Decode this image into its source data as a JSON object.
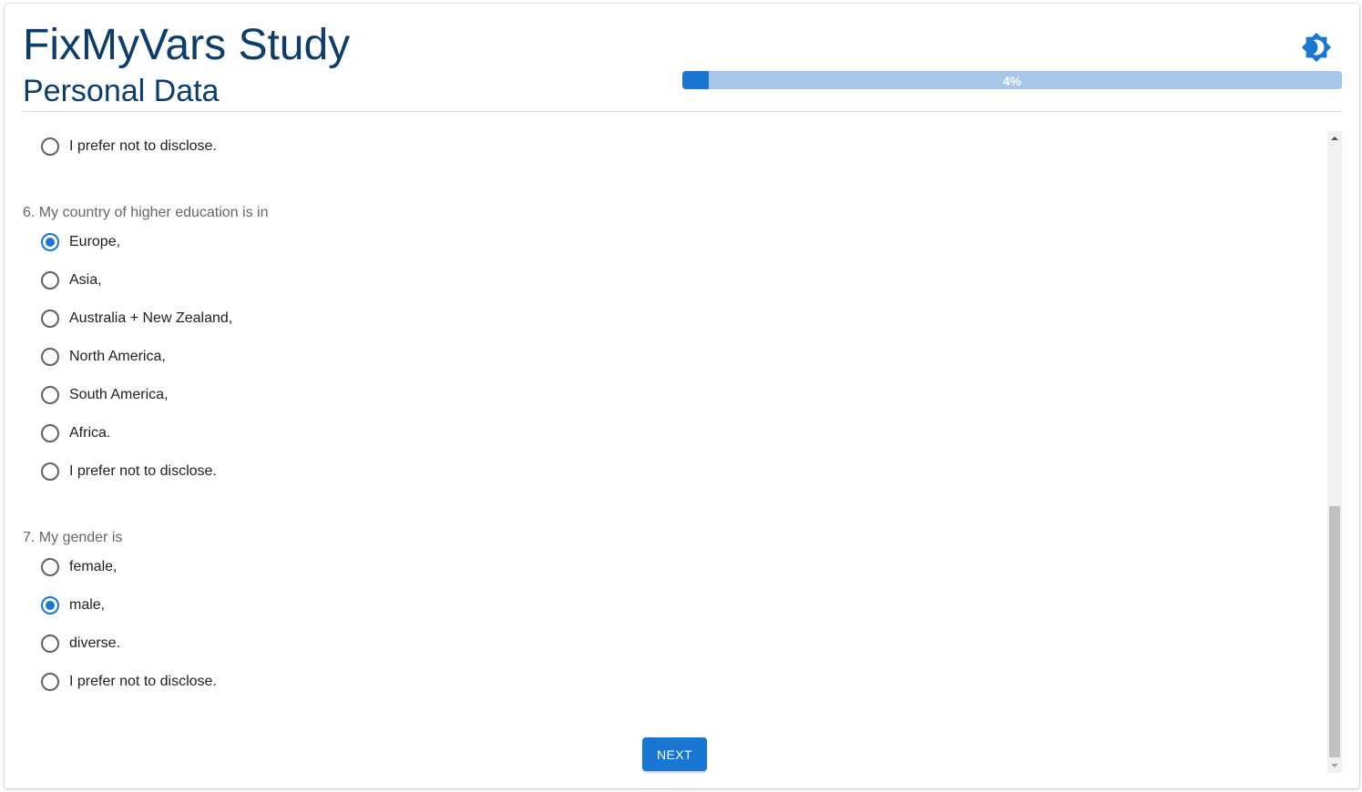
{
  "header": {
    "app_title": "FixMyVars Study",
    "page_title": "Personal Data",
    "theme_toggle_icon": "brightness-icon",
    "progress": {
      "value": 0.04,
      "label": "4%"
    }
  },
  "colors": {
    "accent": "#1976d2",
    "title": "#0d3d6b",
    "progress_track": "#a7c7ea"
  },
  "questions": [
    {
      "label": "",
      "options": [
        {
          "label": "I prefer not to disclose.",
          "checked": false
        }
      ]
    },
    {
      "label": "6. My country of higher education is in",
      "options": [
        {
          "label": "Europe,",
          "checked": true
        },
        {
          "label": "Asia,",
          "checked": false
        },
        {
          "label": "Australia + New Zealand,",
          "checked": false
        },
        {
          "label": "North America,",
          "checked": false
        },
        {
          "label": "South America,",
          "checked": false
        },
        {
          "label": "Africa.",
          "checked": false
        },
        {
          "label": "I prefer not to disclose.",
          "checked": false
        }
      ]
    },
    {
      "label": "7. My gender is",
      "options": [
        {
          "label": "female,",
          "checked": false
        },
        {
          "label": "male,",
          "checked": true
        },
        {
          "label": "diverse.",
          "checked": false
        },
        {
          "label": "I prefer not to disclose.",
          "checked": false
        }
      ]
    }
  ],
  "footer": {
    "next_label": "NEXT"
  }
}
